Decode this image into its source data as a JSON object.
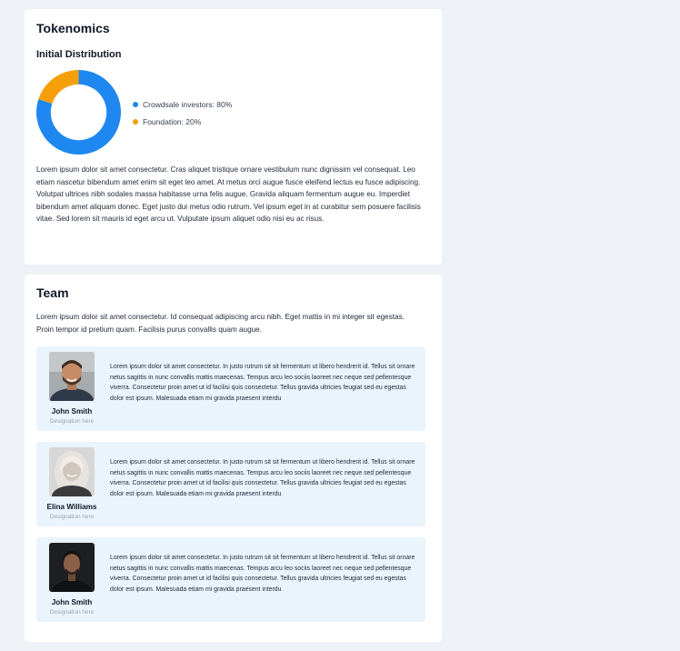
{
  "tokenomics": {
    "title": "Tokenomics",
    "subtitle": "Initial Distribution",
    "legend": [
      {
        "label": "Crowdsale investors: 80%",
        "color": "#1e88f0"
      },
      {
        "label": "Foundation: 20%",
        "color": "#f5a00b"
      }
    ],
    "paragraph": "Lorem ipsum dolor sit amet consectetur. Cras aliquet tristique ornare vestibulum nunc dignissim vel consequat. Leo etiam nascetur bibendum amet enim sit eget leo amet. At metus orci augue fusce eleifend lectus eu fusce adipiscing. Volutpat ultrices nibh sodales massa habitasse urna felis augue. Gravida aliquam fermentum augue eu. Imperdiet bibendum amet aliquam donec. Eget justo dui metus odio rutrum. Vel ipsum eget in at curabitur sem posuere facilisis vitae. Sed lorem sit mauris id eget arcu ut. Vulputate ipsum aliquet odio nisi eu ac risus."
  },
  "chart_data": {
    "type": "pie",
    "categories": [
      "Crowdsale investors",
      "Foundation"
    ],
    "values": [
      80,
      20
    ],
    "colors": [
      "#1e88f0",
      "#f5a00b"
    ],
    "title": "Initial Distribution"
  },
  "team": {
    "title": "Team",
    "paragraph": "Lorem ipsum dolor sit amet consectetur. Id consequat adipiscing arcu nibh. Eget mattis in mi integer sit egestas. Proin tempor id pretium quam. Facilisis purus convallis quam augue.",
    "members": [
      {
        "name": "John Smith",
        "designation": "Designation here",
        "bio": "Lorem ipsum dolor sit amet consectetur. In justo rutrum sit sit fermentum ut libero hendrerit id. Tellus sit ornare netus sagittis in nunc convallis mattis maecenas. Tempus arcu leo sociis laoreet nec neque sed pellentesque viverra. Consectetur proin amet ut id facilisi quis consectetur. Tellus gravida ultricies feugiat sed eu egestas dolor est ipsum. Malesuada etiam mi gravida praesent interdu"
      },
      {
        "name": "Elina Williams",
        "designation": "Designation here",
        "bio": "Lorem ipsum dolor sit amet consectetur. In justo rutrum sit sit fermentum ut libero hendrerit id. Tellus sit ornare netus sagittis in nunc convallis mattis maecenas. Tempus arcu leo sociis laoreet nec neque sed pellentesque viverra. Consectetur proin amet ut id facilisi quis consectetur. Tellus gravida ultricies feugiat sed eu egestas dolor est ipsum. Malesuada etiam mi gravida praesent interdu"
      },
      {
        "name": "John Smith",
        "designation": "Designation here",
        "bio": "Lorem ipsum dolor sit amet consectetur. In justo rutrum sit sit fermentum ut libero hendrerit id. Tellus sit ornare netus sagittis in nunc convallis mattis maecenas. Tempus arcu leo sociis laoreet nec neque sed pellentesque viverra. Consectetur proin amet ut id facilisi quis consectetur. Tellus gravida ultricies feugiat sed eu egestas dolor est ipsum. Malesuada etiam mi gravida praesent interdu"
      }
    ]
  }
}
